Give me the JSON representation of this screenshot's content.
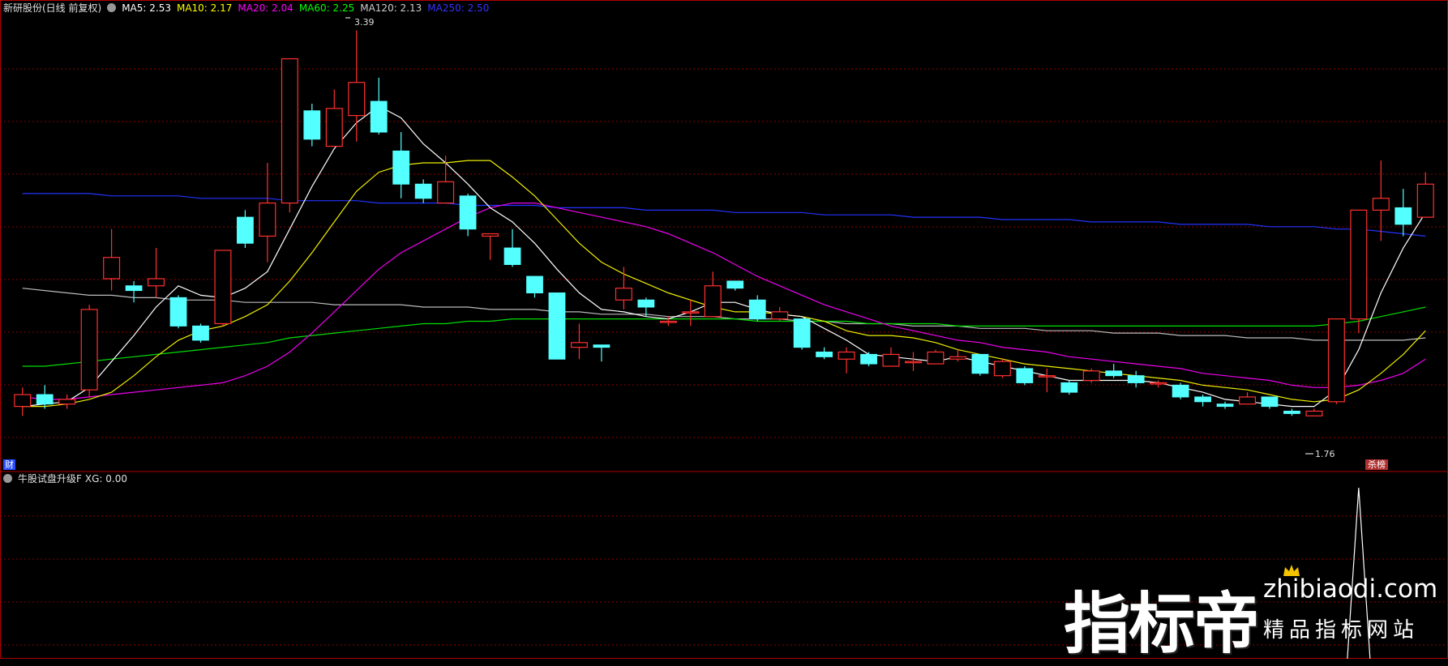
{
  "header_top": {
    "title": "新研股份(日线 前复权)",
    "ma_items": [
      {
        "text": "MA5: 2.53",
        "color": "#ffffff"
      },
      {
        "text": "MA10: 2.17",
        "color": "#ffff00"
      },
      {
        "text": "MA20: 2.04",
        "color": "#ff00ff"
      },
      {
        "text": "MA60: 2.25",
        "color": "#00ff00"
      },
      {
        "text": "MA120: 2.13",
        "color": "#cccccc"
      },
      {
        "text": "MA250: 2.50",
        "color": "#3333ff"
      }
    ]
  },
  "header_bottom": {
    "title": "牛股试盘升级F",
    "xg": "XG: 0.00"
  },
  "markers": {
    "left_badge": "财",
    "right_badge": "杀榜",
    "high_label": "3.39",
    "low_label": "1.76"
  },
  "watermark": {
    "big": "指标帝",
    "url": "zhibiaodi.com",
    "sub": "精品指标网站"
  },
  "colors": {
    "up": "#ff3030",
    "down": "#54ffff",
    "grid": "#8b0000",
    "border": "#b00000"
  },
  "chart_data": {
    "type": "candlestick",
    "y_range": [
      1.6,
      3.45
    ],
    "candles": [
      [
        1.8,
        1.85,
        1.76,
        1.88
      ],
      [
        1.85,
        1.81,
        1.79,
        1.89
      ],
      [
        1.81,
        1.83,
        1.79,
        1.85
      ],
      [
        1.87,
        2.21,
        1.84,
        2.23
      ],
      [
        2.34,
        2.43,
        2.29,
        2.55
      ],
      [
        2.31,
        2.29,
        2.24,
        2.33
      ],
      [
        2.31,
        2.34,
        2.26,
        2.47
      ],
      [
        2.26,
        2.14,
        2.13,
        2.27
      ],
      [
        2.14,
        2.08,
        2.07,
        2.15
      ],
      [
        2.15,
        2.46,
        2.14,
        2.46
      ],
      [
        2.6,
        2.49,
        2.47,
        2.63
      ],
      [
        2.52,
        2.66,
        2.41,
        2.83
      ],
      [
        2.66,
        3.27,
        2.62,
        3.27
      ],
      [
        3.05,
        2.93,
        2.9,
        3.08
      ],
      [
        2.9,
        3.06,
        2.9,
        3.14
      ],
      [
        3.03,
        3.17,
        2.92,
        3.39
      ],
      [
        3.09,
        2.96,
        2.95,
        3.19
      ],
      [
        2.88,
        2.74,
        2.68,
        2.96
      ],
      [
        2.74,
        2.68,
        2.66,
        2.76
      ],
      [
        2.66,
        2.75,
        2.66,
        2.86
      ],
      [
        2.69,
        2.55,
        2.52,
        2.7
      ],
      [
        2.52,
        2.53,
        2.42,
        2.53
      ],
      [
        2.47,
        2.4,
        2.39,
        2.55
      ],
      [
        2.35,
        2.28,
        2.26,
        2.35
      ],
      [
        2.28,
        2.0,
        2.0,
        2.28
      ],
      [
        2.05,
        2.07,
        2.0,
        2.15
      ],
      [
        2.06,
        2.05,
        1.99,
        2.06
      ],
      [
        2.25,
        2.3,
        2.21,
        2.39
      ],
      [
        2.25,
        2.22,
        2.18,
        2.26
      ],
      [
        2.16,
        2.16,
        2.14,
        2.18
      ],
      [
        2.2,
        2.2,
        2.14,
        2.25
      ],
      [
        2.18,
        2.31,
        2.18,
        2.37
      ],
      [
        2.33,
        2.3,
        2.29,
        2.33
      ],
      [
        2.25,
        2.17,
        2.16,
        2.27
      ],
      [
        2.17,
        2.2,
        2.16,
        2.22
      ],
      [
        2.17,
        2.05,
        2.04,
        2.17
      ],
      [
        2.03,
        2.01,
        2.0,
        2.05
      ],
      [
        2.0,
        2.03,
        1.94,
        2.05
      ],
      [
        2.02,
        1.98,
        1.97,
        2.03
      ],
      [
        1.97,
        2.02,
        1.97,
        2.05
      ],
      [
        1.99,
        1.99,
        1.95,
        2.03
      ],
      [
        1.98,
        2.03,
        1.98,
        2.04
      ],
      [
        2.0,
        2.01,
        1.99,
        2.04
      ],
      [
        2.02,
        1.94,
        1.93,
        2.02
      ],
      [
        1.93,
        1.99,
        1.92,
        2.0
      ],
      [
        1.96,
        1.9,
        1.89,
        1.97
      ],
      [
        1.93,
        1.93,
        1.86,
        1.96
      ],
      [
        1.9,
        1.86,
        1.85,
        1.91
      ],
      [
        1.91,
        1.95,
        1.9,
        1.96
      ],
      [
        1.95,
        1.93,
        1.92,
        1.98
      ],
      [
        1.93,
        1.9,
        1.88,
        1.95
      ],
      [
        1.9,
        1.9,
        1.88,
        1.91
      ],
      [
        1.89,
        1.84,
        1.83,
        1.9
      ],
      [
        1.84,
        1.82,
        1.8,
        1.85
      ],
      [
        1.81,
        1.8,
        1.79,
        1.82
      ],
      [
        1.81,
        1.84,
        1.81,
        1.86
      ],
      [
        1.84,
        1.8,
        1.79,
        1.84
      ],
      [
        1.78,
        1.77,
        1.76,
        1.79
      ],
      [
        1.76,
        1.78,
        1.76,
        1.79
      ],
      [
        1.82,
        2.17,
        1.81,
        2.17
      ],
      [
        2.17,
        2.63,
        2.11,
        2.63
      ],
      [
        2.63,
        2.68,
        2.5,
        2.84
      ],
      [
        2.64,
        2.57,
        2.52,
        2.72
      ],
      [
        2.6,
        2.74,
        2.6,
        2.79
      ]
    ],
    "ma5": [
      1.8,
      1.81,
      1.82,
      1.88,
      1.99,
      2.1,
      2.22,
      2.31,
      2.27,
      2.26,
      2.3,
      2.37,
      2.55,
      2.73,
      2.89,
      3.0,
      3.07,
      3.02,
      2.91,
      2.83,
      2.74,
      2.64,
      2.58,
      2.49,
      2.38,
      2.28,
      2.21,
      2.2,
      2.18,
      2.17,
      2.2,
      2.24,
      2.24,
      2.21,
      2.19,
      2.18,
      2.13,
      2.08,
      2.02,
      2.01,
      2.0,
      1.99,
      2.01,
      1.99,
      1.97,
      1.95,
      1.93,
      1.91,
      1.91,
      1.91,
      1.91,
      1.9,
      1.88,
      1.86,
      1.83,
      1.82,
      1.81,
      1.8,
      1.8,
      1.87,
      2.04,
      2.28,
      2.47,
      2.62
    ],
    "ma10": [
      1.8,
      1.8,
      1.81,
      1.83,
      1.86,
      1.93,
      2.01,
      2.08,
      2.12,
      2.14,
      2.18,
      2.23,
      2.33,
      2.45,
      2.58,
      2.71,
      2.79,
      2.82,
      2.83,
      2.83,
      2.84,
      2.84,
      2.77,
      2.69,
      2.59,
      2.49,
      2.41,
      2.36,
      2.32,
      2.28,
      2.25,
      2.22,
      2.2,
      2.2,
      2.19,
      2.18,
      2.16,
      2.12,
      2.1,
      2.1,
      2.09,
      2.07,
      2.04,
      2.02,
      2.0,
      1.98,
      1.97,
      1.96,
      1.95,
      1.94,
      1.93,
      1.92,
      1.91,
      1.89,
      1.88,
      1.87,
      1.85,
      1.83,
      1.82,
      1.83,
      1.87,
      1.94,
      2.02,
      2.12
    ],
    "ma20": [
      1.84,
      1.83,
      1.83,
      1.84,
      1.85,
      1.86,
      1.87,
      1.88,
      1.89,
      1.9,
      1.93,
      1.97,
      2.03,
      2.11,
      2.2,
      2.29,
      2.38,
      2.45,
      2.5,
      2.55,
      2.6,
      2.64,
      2.66,
      2.66,
      2.64,
      2.62,
      2.6,
      2.58,
      2.56,
      2.53,
      2.49,
      2.45,
      2.4,
      2.35,
      2.31,
      2.27,
      2.23,
      2.2,
      2.17,
      2.14,
      2.12,
      2.1,
      2.08,
      2.07,
      2.05,
      2.04,
      2.03,
      2.01,
      2.0,
      1.99,
      1.98,
      1.97,
      1.96,
      1.94,
      1.93,
      1.92,
      1.91,
      1.89,
      1.88,
      1.88,
      1.89,
      1.91,
      1.94,
      2.0
    ],
    "ma60": [
      1.97,
      1.97,
      1.98,
      1.99,
      2.0,
      2.01,
      2.02,
      2.03,
      2.04,
      2.05,
      2.06,
      2.07,
      2.09,
      2.1,
      2.11,
      2.12,
      2.13,
      2.14,
      2.15,
      2.15,
      2.16,
      2.16,
      2.17,
      2.17,
      2.17,
      2.17,
      2.17,
      2.17,
      2.17,
      2.17,
      2.17,
      2.17,
      2.17,
      2.16,
      2.16,
      2.16,
      2.16,
      2.16,
      2.15,
      2.15,
      2.15,
      2.15,
      2.14,
      2.14,
      2.14,
      2.14,
      2.14,
      2.14,
      2.14,
      2.14,
      2.14,
      2.14,
      2.14,
      2.14,
      2.14,
      2.14,
      2.14,
      2.14,
      2.14,
      2.15,
      2.16,
      2.18,
      2.2,
      2.22
    ],
    "ma120": [
      2.3,
      2.29,
      2.28,
      2.27,
      2.27,
      2.26,
      2.26,
      2.25,
      2.25,
      2.25,
      2.24,
      2.24,
      2.24,
      2.24,
      2.23,
      2.23,
      2.23,
      2.23,
      2.22,
      2.22,
      2.22,
      2.21,
      2.21,
      2.21,
      2.2,
      2.2,
      2.19,
      2.19,
      2.19,
      2.18,
      2.18,
      2.18,
      2.17,
      2.17,
      2.17,
      2.16,
      2.16,
      2.15,
      2.15,
      2.15,
      2.14,
      2.14,
      2.14,
      2.13,
      2.13,
      2.13,
      2.12,
      2.12,
      2.12,
      2.11,
      2.11,
      2.11,
      2.1,
      2.1,
      2.1,
      2.09,
      2.09,
      2.09,
      2.08,
      2.08,
      2.08,
      2.08,
      2.08,
      2.09
    ],
    "ma250": [
      2.7,
      2.7,
      2.7,
      2.7,
      2.69,
      2.69,
      2.69,
      2.69,
      2.68,
      2.68,
      2.68,
      2.68,
      2.67,
      2.67,
      2.67,
      2.67,
      2.66,
      2.66,
      2.66,
      2.66,
      2.65,
      2.65,
      2.65,
      2.65,
      2.64,
      2.64,
      2.64,
      2.64,
      2.63,
      2.63,
      2.63,
      2.63,
      2.62,
      2.62,
      2.62,
      2.62,
      2.61,
      2.61,
      2.61,
      2.61,
      2.6,
      2.6,
      2.6,
      2.6,
      2.59,
      2.59,
      2.59,
      2.59,
      2.58,
      2.58,
      2.58,
      2.58,
      2.57,
      2.57,
      2.57,
      2.57,
      2.56,
      2.56,
      2.56,
      2.55,
      2.55,
      2.54,
      2.53,
      2.52
    ],
    "xg": [
      0,
      0,
      0,
      0,
      0,
      0,
      0,
      0,
      0,
      0,
      0,
      0,
      0,
      0,
      0,
      0,
      0,
      0,
      0,
      0,
      0,
      0,
      0,
      0,
      0,
      0,
      0,
      0,
      0,
      0,
      0,
      0,
      0,
      0,
      0,
      0,
      0,
      0,
      0,
      0,
      0,
      0,
      0,
      0,
      0,
      0,
      0,
      0,
      0,
      0,
      0,
      0,
      0,
      0,
      0,
      0,
      0,
      0,
      0,
      0,
      1,
      0,
      0,
      0
    ]
  }
}
